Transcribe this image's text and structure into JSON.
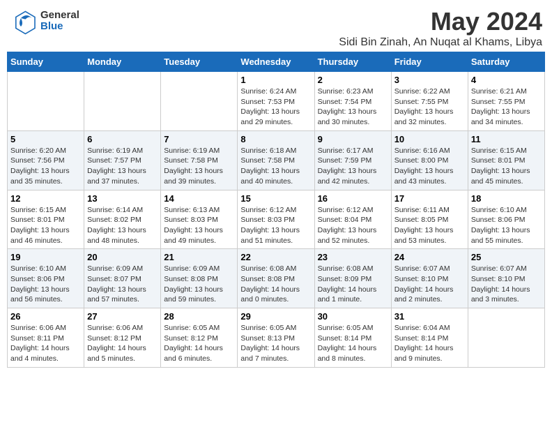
{
  "header": {
    "logo_general": "General",
    "logo_blue": "Blue",
    "month": "May 2024",
    "location": "Sidi Bin Zinah, An Nuqat al Khams, Libya"
  },
  "weekdays": [
    "Sunday",
    "Monday",
    "Tuesday",
    "Wednesday",
    "Thursday",
    "Friday",
    "Saturday"
  ],
  "weeks": [
    [
      {
        "day": "",
        "info": ""
      },
      {
        "day": "",
        "info": ""
      },
      {
        "day": "",
        "info": ""
      },
      {
        "day": "1",
        "info": "Sunrise: 6:24 AM\nSunset: 7:53 PM\nDaylight: 13 hours\nand 29 minutes."
      },
      {
        "day": "2",
        "info": "Sunrise: 6:23 AM\nSunset: 7:54 PM\nDaylight: 13 hours\nand 30 minutes."
      },
      {
        "day": "3",
        "info": "Sunrise: 6:22 AM\nSunset: 7:55 PM\nDaylight: 13 hours\nand 32 minutes."
      },
      {
        "day": "4",
        "info": "Sunrise: 6:21 AM\nSunset: 7:55 PM\nDaylight: 13 hours\nand 34 minutes."
      }
    ],
    [
      {
        "day": "5",
        "info": "Sunrise: 6:20 AM\nSunset: 7:56 PM\nDaylight: 13 hours\nand 35 minutes."
      },
      {
        "day": "6",
        "info": "Sunrise: 6:19 AM\nSunset: 7:57 PM\nDaylight: 13 hours\nand 37 minutes."
      },
      {
        "day": "7",
        "info": "Sunrise: 6:19 AM\nSunset: 7:58 PM\nDaylight: 13 hours\nand 39 minutes."
      },
      {
        "day": "8",
        "info": "Sunrise: 6:18 AM\nSunset: 7:58 PM\nDaylight: 13 hours\nand 40 minutes."
      },
      {
        "day": "9",
        "info": "Sunrise: 6:17 AM\nSunset: 7:59 PM\nDaylight: 13 hours\nand 42 minutes."
      },
      {
        "day": "10",
        "info": "Sunrise: 6:16 AM\nSunset: 8:00 PM\nDaylight: 13 hours\nand 43 minutes."
      },
      {
        "day": "11",
        "info": "Sunrise: 6:15 AM\nSunset: 8:01 PM\nDaylight: 13 hours\nand 45 minutes."
      }
    ],
    [
      {
        "day": "12",
        "info": "Sunrise: 6:15 AM\nSunset: 8:01 PM\nDaylight: 13 hours\nand 46 minutes."
      },
      {
        "day": "13",
        "info": "Sunrise: 6:14 AM\nSunset: 8:02 PM\nDaylight: 13 hours\nand 48 minutes."
      },
      {
        "day": "14",
        "info": "Sunrise: 6:13 AM\nSunset: 8:03 PM\nDaylight: 13 hours\nand 49 minutes."
      },
      {
        "day": "15",
        "info": "Sunrise: 6:12 AM\nSunset: 8:03 PM\nDaylight: 13 hours\nand 51 minutes."
      },
      {
        "day": "16",
        "info": "Sunrise: 6:12 AM\nSunset: 8:04 PM\nDaylight: 13 hours\nand 52 minutes."
      },
      {
        "day": "17",
        "info": "Sunrise: 6:11 AM\nSunset: 8:05 PM\nDaylight: 13 hours\nand 53 minutes."
      },
      {
        "day": "18",
        "info": "Sunrise: 6:10 AM\nSunset: 8:06 PM\nDaylight: 13 hours\nand 55 minutes."
      }
    ],
    [
      {
        "day": "19",
        "info": "Sunrise: 6:10 AM\nSunset: 8:06 PM\nDaylight: 13 hours\nand 56 minutes."
      },
      {
        "day": "20",
        "info": "Sunrise: 6:09 AM\nSunset: 8:07 PM\nDaylight: 13 hours\nand 57 minutes."
      },
      {
        "day": "21",
        "info": "Sunrise: 6:09 AM\nSunset: 8:08 PM\nDaylight: 13 hours\nand 59 minutes."
      },
      {
        "day": "22",
        "info": "Sunrise: 6:08 AM\nSunset: 8:08 PM\nDaylight: 14 hours\nand 0 minutes."
      },
      {
        "day": "23",
        "info": "Sunrise: 6:08 AM\nSunset: 8:09 PM\nDaylight: 14 hours\nand 1 minute."
      },
      {
        "day": "24",
        "info": "Sunrise: 6:07 AM\nSunset: 8:10 PM\nDaylight: 14 hours\nand 2 minutes."
      },
      {
        "day": "25",
        "info": "Sunrise: 6:07 AM\nSunset: 8:10 PM\nDaylight: 14 hours\nand 3 minutes."
      }
    ],
    [
      {
        "day": "26",
        "info": "Sunrise: 6:06 AM\nSunset: 8:11 PM\nDaylight: 14 hours\nand 4 minutes."
      },
      {
        "day": "27",
        "info": "Sunrise: 6:06 AM\nSunset: 8:12 PM\nDaylight: 14 hours\nand 5 minutes."
      },
      {
        "day": "28",
        "info": "Sunrise: 6:05 AM\nSunset: 8:12 PM\nDaylight: 14 hours\nand 6 minutes."
      },
      {
        "day": "29",
        "info": "Sunrise: 6:05 AM\nSunset: 8:13 PM\nDaylight: 14 hours\nand 7 minutes."
      },
      {
        "day": "30",
        "info": "Sunrise: 6:05 AM\nSunset: 8:14 PM\nDaylight: 14 hours\nand 8 minutes."
      },
      {
        "day": "31",
        "info": "Sunrise: 6:04 AM\nSunset: 8:14 PM\nDaylight: 14 hours\nand 9 minutes."
      },
      {
        "day": "",
        "info": ""
      }
    ]
  ]
}
